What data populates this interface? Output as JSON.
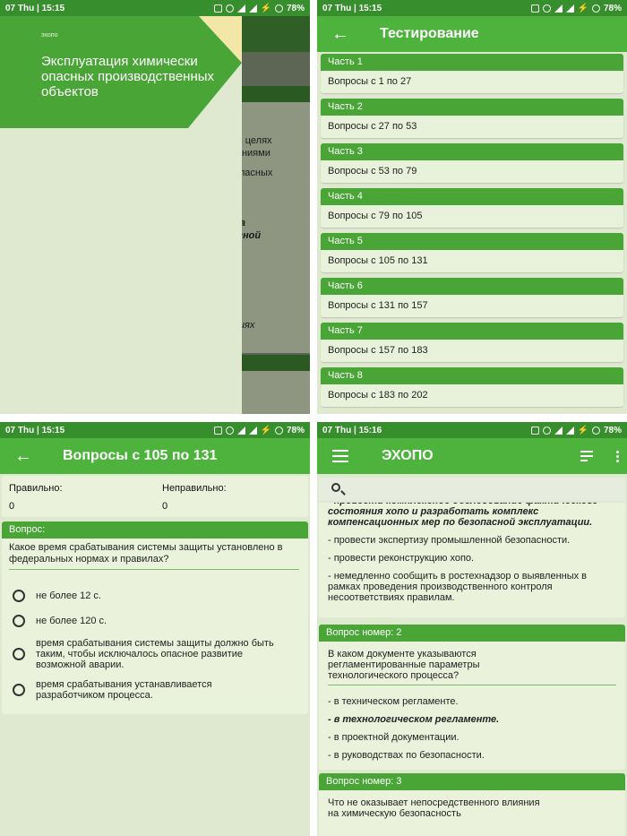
{
  "status": {
    "p1": {
      "time": "07 Thu | 15:15",
      "battery": "78%"
    },
    "p2": {
      "time": "07 Thu | 15:15",
      "battery": "78%"
    },
    "p3": {
      "time": "07 Thu | 15:15",
      "battery": "78%"
    },
    "p4": {
      "time": "07 Thu | 15:16",
      "battery": "78%"
    }
  },
  "drawer": {
    "logo_small": "эхопо",
    "title": "Эксплуатация химически опасных производственных объектов",
    "bg_fragments": [
      "ии,",
      "о) в целях",
      "ованиями",
      "и опасных",
      "ата",
      "пасной",
      "твиях"
    ]
  },
  "testing": {
    "title": "Тестирование",
    "parts": [
      {
        "label": "Часть 1",
        "range": "Вопросы с 1 по 27"
      },
      {
        "label": "Часть 2",
        "range": "Вопросы с 27 по 53"
      },
      {
        "label": "Часть 3",
        "range": "Вопросы с 53 по 79"
      },
      {
        "label": "Часть 4",
        "range": "Вопросы с 79 по 105"
      },
      {
        "label": "Часть 5",
        "range": "Вопросы с 105 по 131"
      },
      {
        "label": "Часть 6",
        "range": "Вопросы с 131 по 157"
      },
      {
        "label": "Часть 7",
        "range": "Вопросы с 157 по 183"
      },
      {
        "label": "Часть 8",
        "range": "Вопросы с 183 по 202"
      }
    ]
  },
  "quiz": {
    "title": "Вопросы с 105 по 131",
    "correct_label": "Правильно:",
    "wrong_label": "Неправильно:",
    "correct_value": "0",
    "wrong_value": "0",
    "question_label": "Вопрос:",
    "question": "Какое время срабатывания системы защиты установлено в федеральных нормах и правилах?",
    "options": [
      "не более 12 с.",
      "не более 120 с.",
      "время срабатывания системы защиты должно быть таким, чтобы исключалось опасное развитие возможной аварии.",
      "время срабатывания устанавливается разработчиком процесса."
    ]
  },
  "main": {
    "title": "ЭХОПО",
    "search_placeholder": "",
    "q1_bold": "- провести комплексное обследование фактического состояния хопо и разработать комплекс компенсационных мер по безопасной эксплуатации.",
    "q1_answers": [
      "- провести экспертизу промышленной безопасности.",
      "- провести реконструкцию хопо.",
      "- немедленно сообщить в ростехнадзор о выявленных в рамках проведения производственного контроля несоответствиях правилам."
    ],
    "q2_label": "Вопрос номер: 2",
    "q2_text": "В каком документе указываются регламентированные параметры технологического процесса?",
    "q2_answers": [
      "- в техническом регламенте.",
      "- в технологическом регламенте.",
      "- в проектной документации.",
      "- в руководствах по безопасности."
    ],
    "q3_label": "Вопрос номер: 3",
    "q3_text": "Что не оказывает непосредственного влияния на химическую безопасность"
  },
  "colors": {
    "statusbar": "#378e2c",
    "appbar": "#4db33d",
    "card_header": "#4aa537",
    "card_body": "#eaf2dc",
    "background": "#dfe9cf"
  }
}
